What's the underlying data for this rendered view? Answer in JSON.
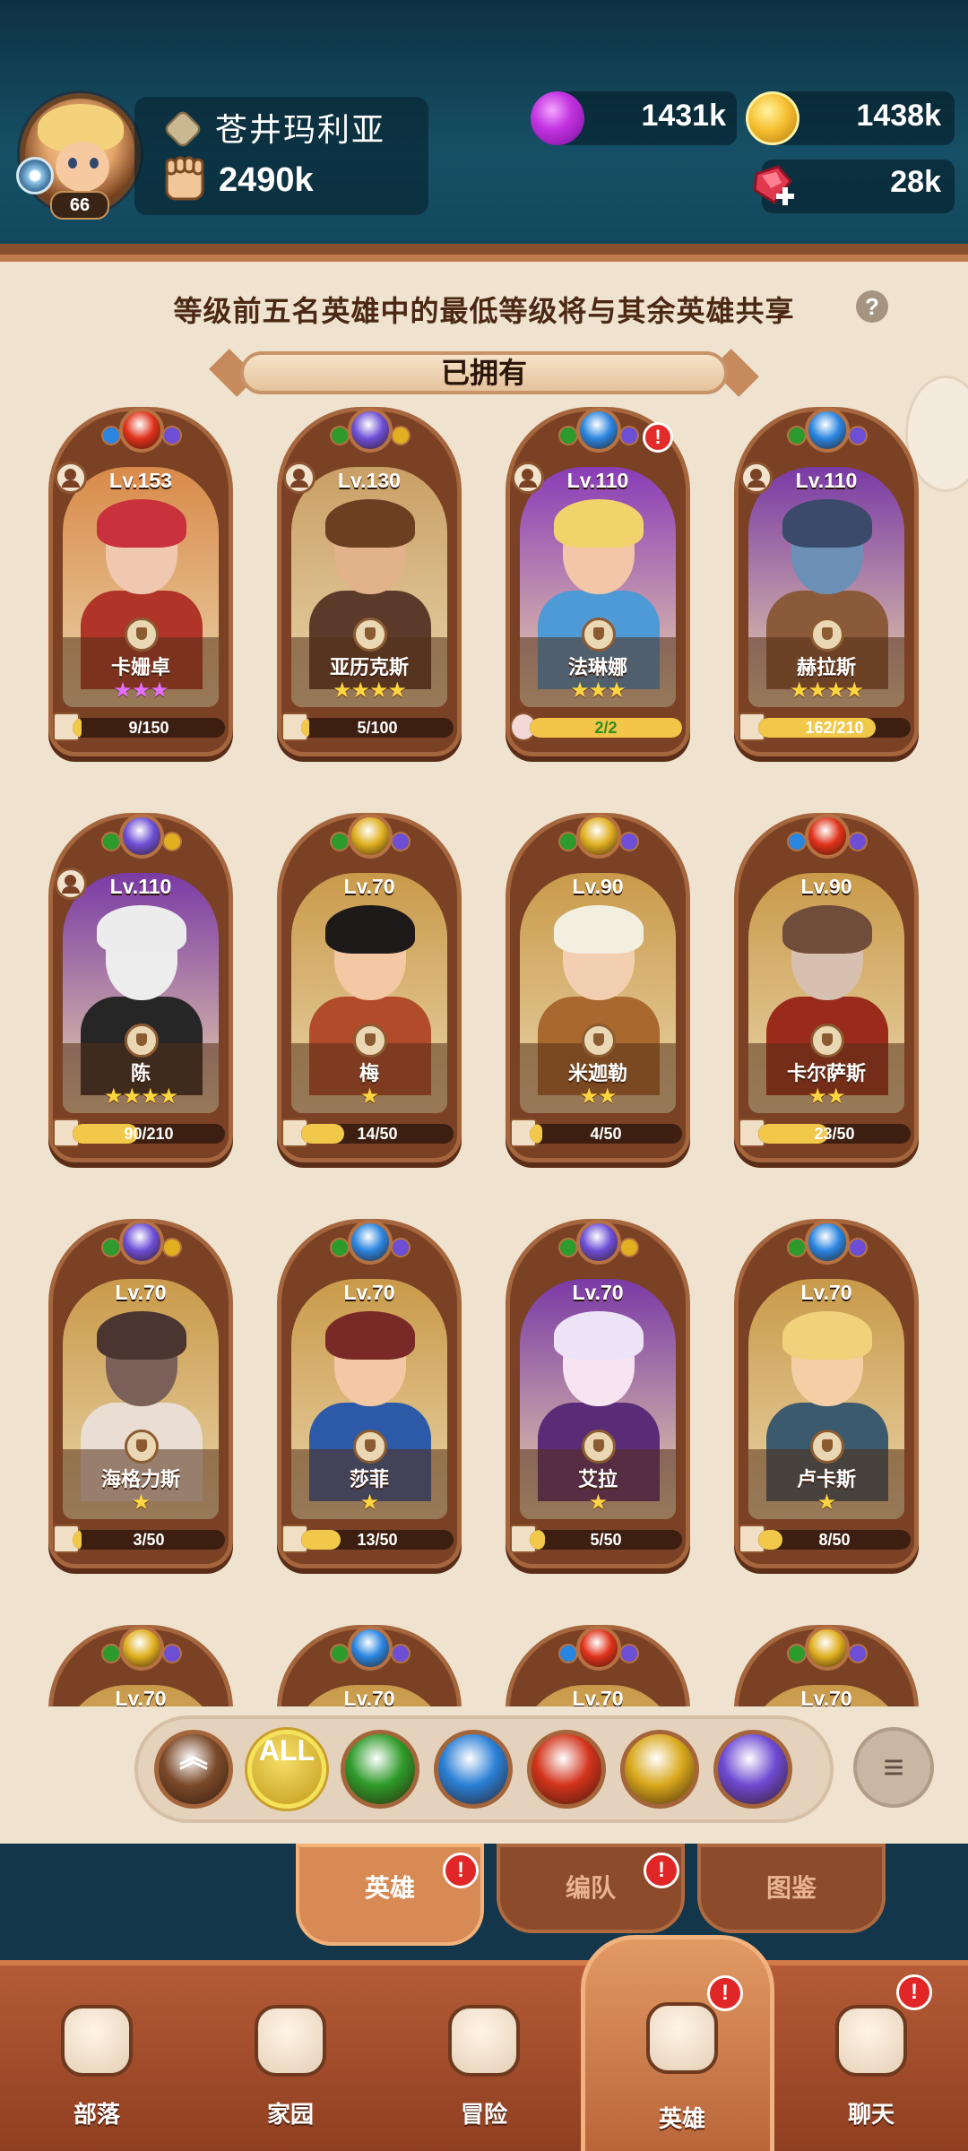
{
  "player": {
    "name": "苍井玛利亚",
    "level": "66",
    "power": "2490k"
  },
  "resources": {
    "elixir": "1431k",
    "gold": "1438k",
    "gems": "28k"
  },
  "panel": {
    "share_note": "等级前五名英雄中的最低等级将与其余英雄共享",
    "help": "?",
    "owned_label": "已拥有"
  },
  "heroes": [
    {
      "name": "卡姗卓",
      "level": "Lv.153",
      "stars": "★★★",
      "star_color": "#e36fff",
      "shards": "9/150",
      "shard_progress": 0.06,
      "element": "fire",
      "team": true,
      "alert": false
    },
    {
      "name": "亚历克斯",
      "level": "Lv.130",
      "stars": "★★★★",
      "star_color": "#ffd640",
      "shards": "5/100",
      "shard_progress": 0.05,
      "element": "moon",
      "team": true,
      "alert": false
    },
    {
      "name": "法琳娜",
      "level": "Lv.110",
      "stars": "★★★",
      "star_color": "#ffd640",
      "shards": "2/2",
      "shard_progress": 1.0,
      "element": "water",
      "team": true,
      "alert": true
    },
    {
      "name": "赫拉斯",
      "level": "Lv.110",
      "stars": "★★★★",
      "star_color": "#ffd640",
      "shards": "162/210",
      "shard_progress": 0.77,
      "element": "water",
      "team": true,
      "alert": false
    },
    {
      "name": "陈",
      "level": "Lv.110",
      "stars": "★★★★",
      "star_color": "#ffd640",
      "shards": "90/210",
      "shard_progress": 0.43,
      "element": "moon",
      "team": true,
      "alert": false
    },
    {
      "name": "梅",
      "level": "Lv.70",
      "stars": "★",
      "star_color": "#ffd640",
      "shards": "14/50",
      "shard_progress": 0.28,
      "element": "star",
      "team": false,
      "alert": false
    },
    {
      "name": "米迦勒",
      "level": "Lv.90",
      "stars": "★★",
      "star_color": "#ffd640",
      "shards": "4/50",
      "shard_progress": 0.08,
      "element": "star",
      "team": false,
      "alert": false
    },
    {
      "name": "卡尔萨斯",
      "level": "Lv.90",
      "stars": "★★",
      "star_color": "#ffd640",
      "shards": "23/50",
      "shard_progress": 0.46,
      "element": "fire",
      "team": false,
      "alert": false
    },
    {
      "name": "海格力斯",
      "level": "Lv.70",
      "stars": "★",
      "star_color": "#ffd640",
      "shards": "3/50",
      "shard_progress": 0.06,
      "element": "moon",
      "team": false,
      "alert": false
    },
    {
      "name": "莎菲",
      "level": "Lv.70",
      "stars": "★",
      "star_color": "#ffd640",
      "shards": "13/50",
      "shard_progress": 0.26,
      "element": "water",
      "team": false,
      "alert": false
    },
    {
      "name": "艾拉",
      "level": "Lv.70",
      "stars": "★",
      "star_color": "#ffd640",
      "shards": "5/50",
      "shard_progress": 0.1,
      "element": "moon",
      "team": false,
      "alert": false
    },
    {
      "name": "卢卡斯",
      "level": "Lv.70",
      "stars": "★",
      "star_color": "#ffd640",
      "shards": "8/50",
      "shard_progress": 0.16,
      "element": "water",
      "team": false,
      "alert": false
    },
    {
      "name": "",
      "level": "Lv.70",
      "stars": "",
      "star_color": "#ffd640",
      "shards": "",
      "shard_progress": 0,
      "element": "star",
      "team": false,
      "alert": false
    },
    {
      "name": "",
      "level": "Lv.70",
      "stars": "",
      "star_color": "#ffd640",
      "shards": "",
      "shard_progress": 0,
      "element": "water",
      "team": false,
      "alert": false
    },
    {
      "name": "",
      "level": "Lv.70",
      "stars": "",
      "star_color": "#ffd640",
      "shards": "",
      "shard_progress": 0,
      "element": "fire",
      "team": false,
      "alert": false
    },
    {
      "name": "",
      "level": "Lv.70",
      "stars": "",
      "star_color": "#ffd640",
      "shards": "",
      "shard_progress": 0,
      "element": "star",
      "team": false,
      "alert": false
    }
  ],
  "filters": [
    {
      "id": "rarity",
      "label": "︽",
      "color": "#7b4a2b"
    },
    {
      "id": "all",
      "label": "ALL",
      "color": "#d9b22a"
    },
    {
      "id": "nature",
      "label": "",
      "color": "#2f9b2a"
    },
    {
      "id": "water",
      "label": "",
      "color": "#2a7fd6"
    },
    {
      "id": "fire",
      "label": "",
      "color": "#d3341c"
    },
    {
      "id": "light",
      "label": "",
      "color": "#d9a81c"
    },
    {
      "id": "dark",
      "label": "",
      "color": "#6e4ad2"
    }
  ],
  "sort_label": "≡",
  "subtabs": [
    {
      "label": "英雄",
      "active": true,
      "badge": "!"
    },
    {
      "label": "编队",
      "active": false,
      "badge": "!"
    },
    {
      "label": "图鉴",
      "active": false,
      "badge": ""
    }
  ],
  "nav": [
    {
      "label": "部落",
      "icon": "tribe-icon",
      "active": false,
      "badge": ""
    },
    {
      "label": "家园",
      "icon": "home-icon",
      "active": false,
      "badge": ""
    },
    {
      "label": "冒险",
      "icon": "crossed-swords-icon",
      "active": false,
      "badge": ""
    },
    {
      "label": "英雄",
      "icon": "viking-helmet-icon",
      "active": true,
      "badge": "!"
    },
    {
      "label": "聊天",
      "icon": "chat-icon",
      "active": false,
      "badge": "!"
    }
  ],
  "colors": {
    "fire": "#e0321a",
    "water": "#2a85e0",
    "moon": "#6d4fd6",
    "star": "#e0b021",
    "nature": "#2c9a2c",
    "card_gold": "#c99a4a",
    "card_purple": "#8a3cb8"
  }
}
